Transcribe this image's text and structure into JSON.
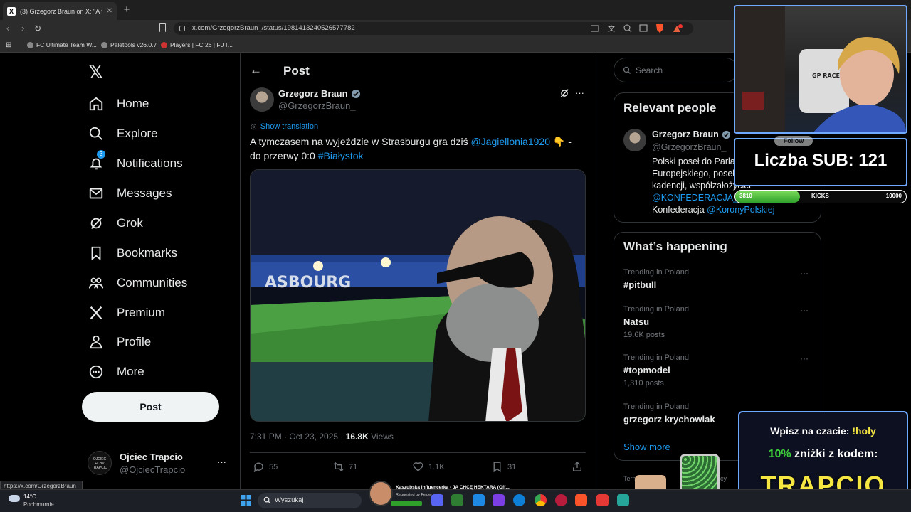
{
  "browser": {
    "tab_title": "(3) Grzegorz Braun on X: \"A tym...",
    "tab_icon": "X",
    "url": "x.com/GrzegorzBraun_/status/1981413240526577782",
    "bookmarks": [
      "FC Ultimate Team W...",
      "Paletools v26.0.7",
      "Players | FC 26 | FUT..."
    ]
  },
  "nav": {
    "items": [
      {
        "label": "Home",
        "icon": "home-icon"
      },
      {
        "label": "Explore",
        "icon": "search-icon"
      },
      {
        "label": "Notifications",
        "icon": "bell-icon",
        "badge": "3"
      },
      {
        "label": "Messages",
        "icon": "mail-icon"
      },
      {
        "label": "Grok",
        "icon": "grok-icon"
      },
      {
        "label": "Bookmarks",
        "icon": "bookmark-icon"
      },
      {
        "label": "Communities",
        "icon": "people-icon"
      },
      {
        "label": "Premium",
        "icon": "x-icon"
      },
      {
        "label": "Profile",
        "icon": "person-icon"
      },
      {
        "label": "More",
        "icon": "more-circle-icon"
      }
    ],
    "post_button": "Post",
    "account": {
      "name": "Ojciec Trapcio",
      "handle": "@OjciecTrapcio",
      "avatar_text": "OJCIEC FCBV TRAPCIO"
    }
  },
  "post": {
    "header": "Post",
    "author_name": "Grzegorz Braun",
    "author_handle": "@GrzegorzBraun_",
    "show_translation": "Show translation",
    "text_before": "A tymczasem na wyjeździe w Strasburgu gra dziś ",
    "mention": "@Jagiellonia1920",
    "text_after": " 👇 - do przerwy 0:0 ",
    "hashtag": "#Białystok",
    "image_stadium_text": "ASBOURG",
    "time": "7:31 PM · Oct 23, 2025 · ",
    "views_count": "16.8K",
    "views_label": " Views",
    "replies": "55",
    "reposts": "71",
    "likes": "1.1K",
    "bookmarks": "31"
  },
  "search": {
    "placeholder": "Search"
  },
  "relevant": {
    "title": "Relevant people",
    "name": "Grzegorz Braun",
    "handle": "@GrzegorzBraun_",
    "follow": "Follow",
    "bio_line1": "Polski poseł do Parlamentu",
    "bio_line2": "Europejskiego, poseł na Sejm RP IX i X",
    "bio_line3": "kadencji, współzałożyciel",
    "bio_mention1": "@KONFEDERACJA_",
    "bio_sep": " , ",
    "bio_line5a": "Konfederacja ",
    "bio_mention2": "@KoronyPolskiej"
  },
  "trending": {
    "title": "What’s happening",
    "items": [
      {
        "context": "Trending in Poland",
        "topic": "#pitbull",
        "posts": ""
      },
      {
        "context": "Trending in Poland",
        "topic": "Natsu",
        "posts": "19.6K posts"
      },
      {
        "context": "Trending in Poland",
        "topic": "#topmodel",
        "posts": "1,310 posts"
      },
      {
        "context": "Trending in Poland",
        "topic": "grzegorz krychowiak",
        "posts": ""
      }
    ],
    "show_more": "Show more",
    "footer_left": "Term",
    "footer_right": "cy"
  },
  "overlay": {
    "sub_label": "Liczba SUB: 121",
    "bar_current": "3810",
    "bar_label": "KICKS",
    "bar_goal": "10000",
    "bar_fraction": 0.381,
    "chair_brand": "GP RACER",
    "promo_line1_a": "Wpisz na czacie: ",
    "promo_line1_b": "!holy",
    "promo_line2_a": "10%",
    "promo_line2_b": " zniżki z kodem:",
    "promo_code": "TRAPCIO"
  },
  "statusbar": {
    "url": "https://x.com/GrzegorzBraun_"
  },
  "taskbar": {
    "temp": "14°C",
    "weather": "Pochmurnie",
    "search": "Wyszukaj",
    "media_title": "Kaszubska influencerka - JA CHCĘ HEKTARA (Off...",
    "media_sub": "Requested by Felper"
  },
  "colors": {
    "accent": "#1d9bf0",
    "green": "#22c55e",
    "yellow": "#f5e642",
    "overlay_border": "#6fa8ff"
  }
}
